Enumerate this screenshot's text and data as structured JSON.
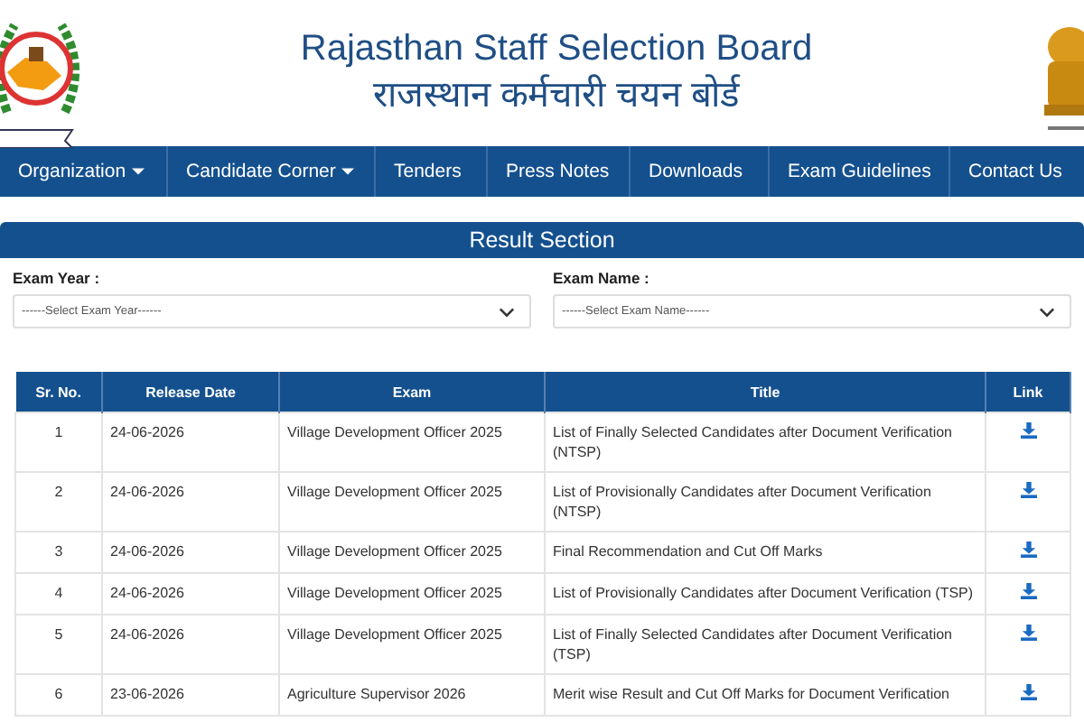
{
  "header": {
    "title": "Rajasthan Staff Selection Board",
    "subtitle": "राजस्थान कर्मचारी चयन बोर्ड"
  },
  "nav": [
    {
      "label": "Organization",
      "dropdown": true
    },
    {
      "label": "Candidate Corner",
      "dropdown": true
    },
    {
      "label": "Tenders",
      "dropdown": false
    },
    {
      "label": "Press Notes",
      "dropdown": false
    },
    {
      "label": "Downloads",
      "dropdown": false
    },
    {
      "label": "Exam Guidelines",
      "dropdown": false
    },
    {
      "label": "Contact Us",
      "dropdown": false
    }
  ],
  "section_title": "Result Section",
  "filters": [
    {
      "label": "Exam Year :",
      "placeholder": "------Select Exam Year------"
    },
    {
      "label": "Exam Name :",
      "placeholder": "------Select Exam Name------"
    }
  ],
  "table": {
    "columns": [
      "Sr. No.",
      "Release Date",
      "Exam",
      "Title",
      "Link"
    ],
    "rows": [
      {
        "sr": "1",
        "date": "24-06-2026",
        "exam": "Village Development Officer 2025",
        "title": "List of Finally Selected Candidates after Document Verification (NTSP)"
      },
      {
        "sr": "2",
        "date": "24-06-2026",
        "exam": "Village Development Officer 2025",
        "title": "List of Provisionally Candidates after Document Verification (NTSP)"
      },
      {
        "sr": "3",
        "date": "24-06-2026",
        "exam": "Village Development Officer 2025",
        "title": "Final Recommendation and Cut Off Marks"
      },
      {
        "sr": "4",
        "date": "24-06-2026",
        "exam": "Village Development Officer 2025",
        "title": "List of Provisionally Candidates after Document Verification (TSP)"
      },
      {
        "sr": "5",
        "date": "24-06-2026",
        "exam": "Village Development Officer 2025",
        "title": "List of Finally Selected Candidates after Document Verification (TSP)"
      },
      {
        "sr": "6",
        "date": "23-06-2026",
        "exam": "Agriculture Supervisor 2026",
        "title": "Merit wise Result and Cut Off Marks for Document Verification"
      }
    ]
  }
}
